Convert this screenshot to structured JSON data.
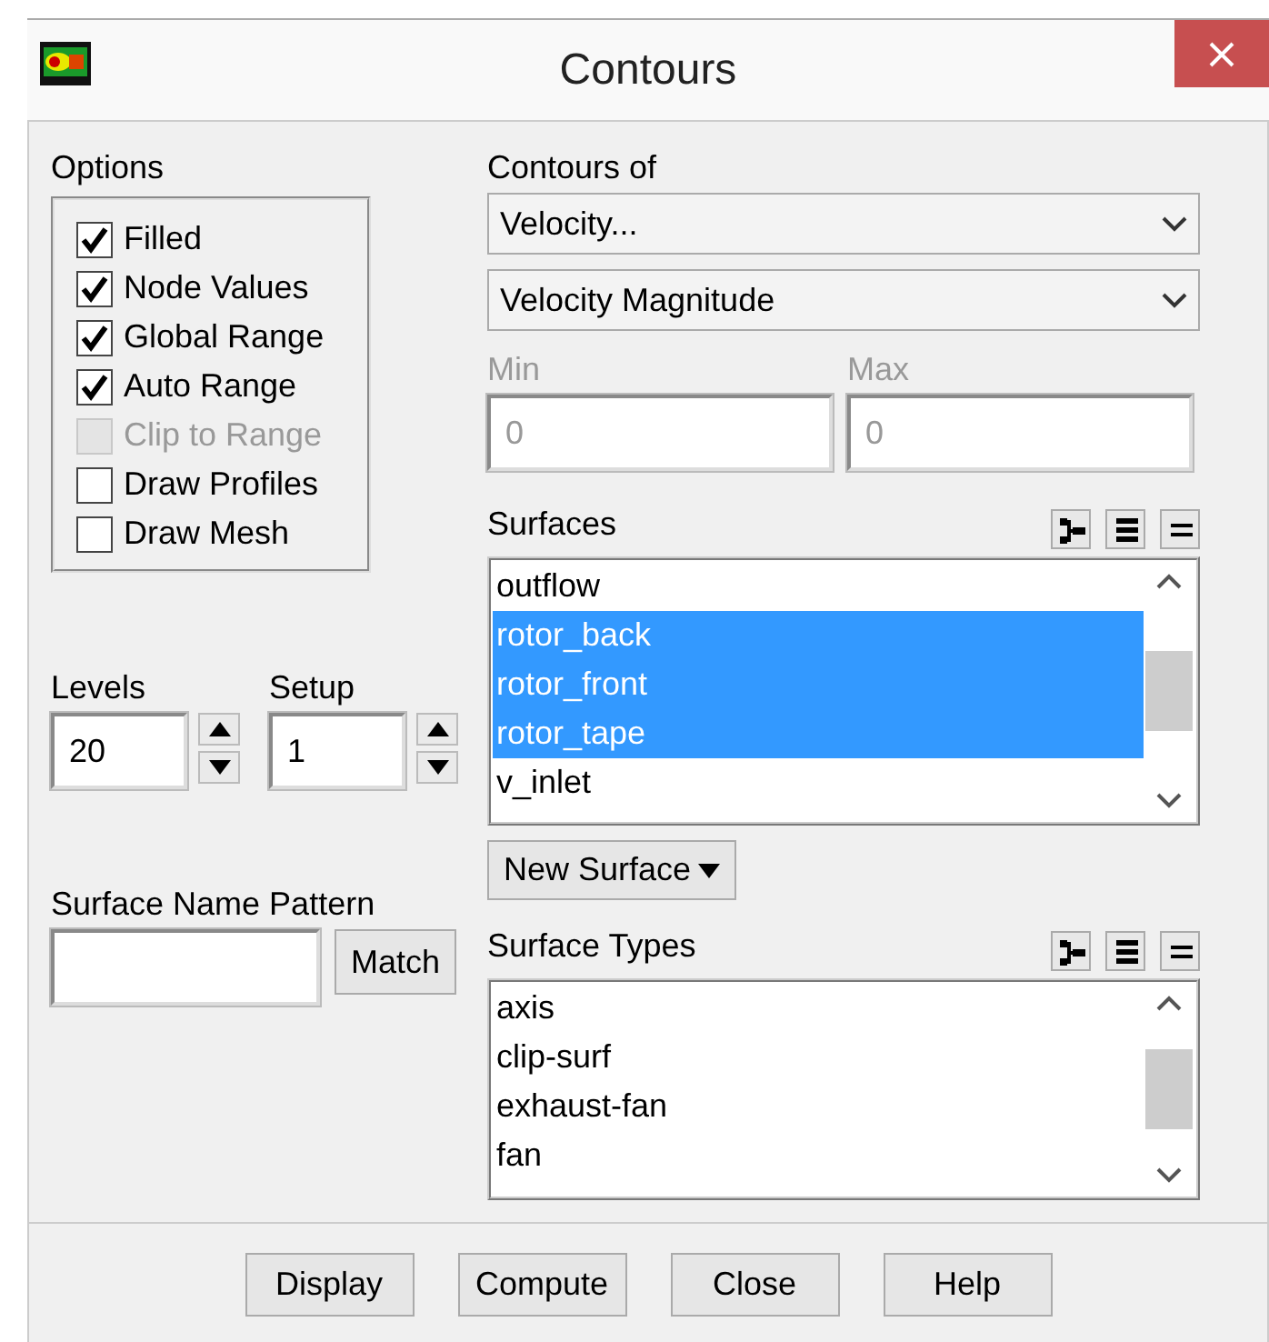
{
  "window": {
    "title": "Contours"
  },
  "options": {
    "label": "Options",
    "items": [
      {
        "label": "Filled",
        "checked": true,
        "disabled": false
      },
      {
        "label": "Node Values",
        "checked": true,
        "disabled": false
      },
      {
        "label": "Global Range",
        "checked": true,
        "disabled": false
      },
      {
        "label": "Auto Range",
        "checked": true,
        "disabled": false
      },
      {
        "label": "Clip to Range",
        "checked": false,
        "disabled": true
      },
      {
        "label": "Draw Profiles",
        "checked": false,
        "disabled": false
      },
      {
        "label": "Draw Mesh",
        "checked": false,
        "disabled": false
      }
    ]
  },
  "levels": {
    "label": "Levels",
    "value": "20"
  },
  "setup": {
    "label": "Setup",
    "value": "1"
  },
  "pattern": {
    "label": "Surface Name Pattern",
    "button": "Match"
  },
  "contours_of": {
    "label": "Contours of",
    "selects": [
      "Velocity...",
      "Velocity Magnitude"
    ]
  },
  "min": {
    "label": "Min",
    "value": "0",
    "disabled": true
  },
  "max": {
    "label": "Max",
    "value": "0",
    "disabled": true
  },
  "surfaces": {
    "label": "Surfaces",
    "items": [
      {
        "label": "outflow",
        "selected": false
      },
      {
        "label": "rotor_back",
        "selected": true
      },
      {
        "label": "rotor_front",
        "selected": true
      },
      {
        "label": "rotor_tape",
        "selected": true
      },
      {
        "label": "v_inlet",
        "selected": false
      }
    ]
  },
  "new_surface": {
    "label": "New Surface"
  },
  "surface_types": {
    "label": "Surface Types",
    "items": [
      {
        "label": "axis",
        "selected": false
      },
      {
        "label": "clip-surf",
        "selected": false
      },
      {
        "label": "exhaust-fan",
        "selected": false
      },
      {
        "label": "fan",
        "selected": false
      }
    ]
  },
  "buttons": [
    "Display",
    "Compute",
    "Close",
    "Help"
  ]
}
